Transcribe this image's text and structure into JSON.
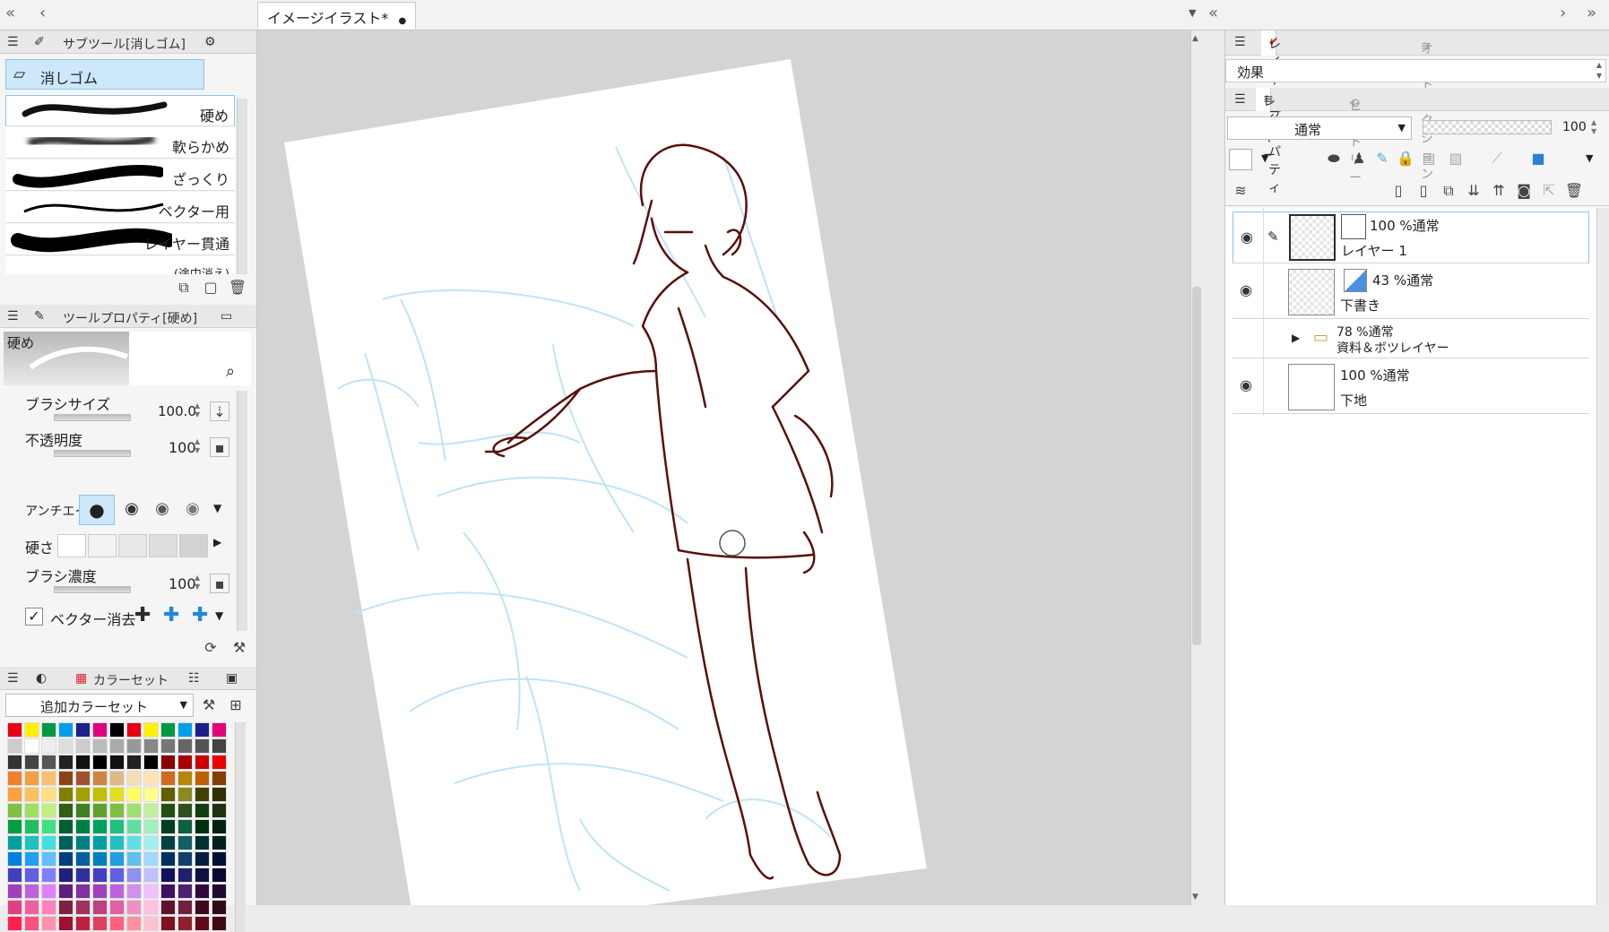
{
  "document": {
    "tab_title": "イメージイラスト*"
  },
  "subtool": {
    "header": "サブツール[消しゴム]",
    "group": "消しゴム",
    "brushes": [
      "硬め",
      "軟らかめ",
      "ざっくり",
      "ベクター用",
      "レイヤー貫通",
      "(途中消え)"
    ]
  },
  "tool_property": {
    "header": "ツールプロパティ[硬め]",
    "preset": "硬め",
    "brush_size_label": "ブラシサイズ",
    "brush_size_value": "100.0",
    "brush_size_level": 0.7,
    "opacity_label": "不透明度",
    "opacity_value": "100",
    "antialias_label": "アンチエイ",
    "hardness_label": "硬さ",
    "density_label": "ブラシ濃度",
    "density_value": "100",
    "vector_erase_label": "ベクター消去"
  },
  "color_set": {
    "header": "カラーセット",
    "preset": "追加カラーセット"
  },
  "layer_property": {
    "tab_active": "レイヤープロパティ",
    "tab_inactive": "オートアクション",
    "effect_label": "効果"
  },
  "layer_panel": {
    "tab_active": "レイヤー",
    "tab_inactive": "ヒストリー",
    "blend_mode": "通常",
    "opacity": "100",
    "layers": [
      {
        "mode": "100 %通常",
        "name": "レイヤー 1"
      },
      {
        "mode": "43 %通常",
        "name": "下書き"
      },
      {
        "mode": "78 %通常",
        "name": "資料＆ボツレイヤー"
      },
      {
        "mode": "100 %通常",
        "name": "下地"
      }
    ]
  },
  "colors": {
    "accent": "#8cc4ee",
    "stroke": "#5a0f0a",
    "sketch": "#bfe4f5"
  }
}
